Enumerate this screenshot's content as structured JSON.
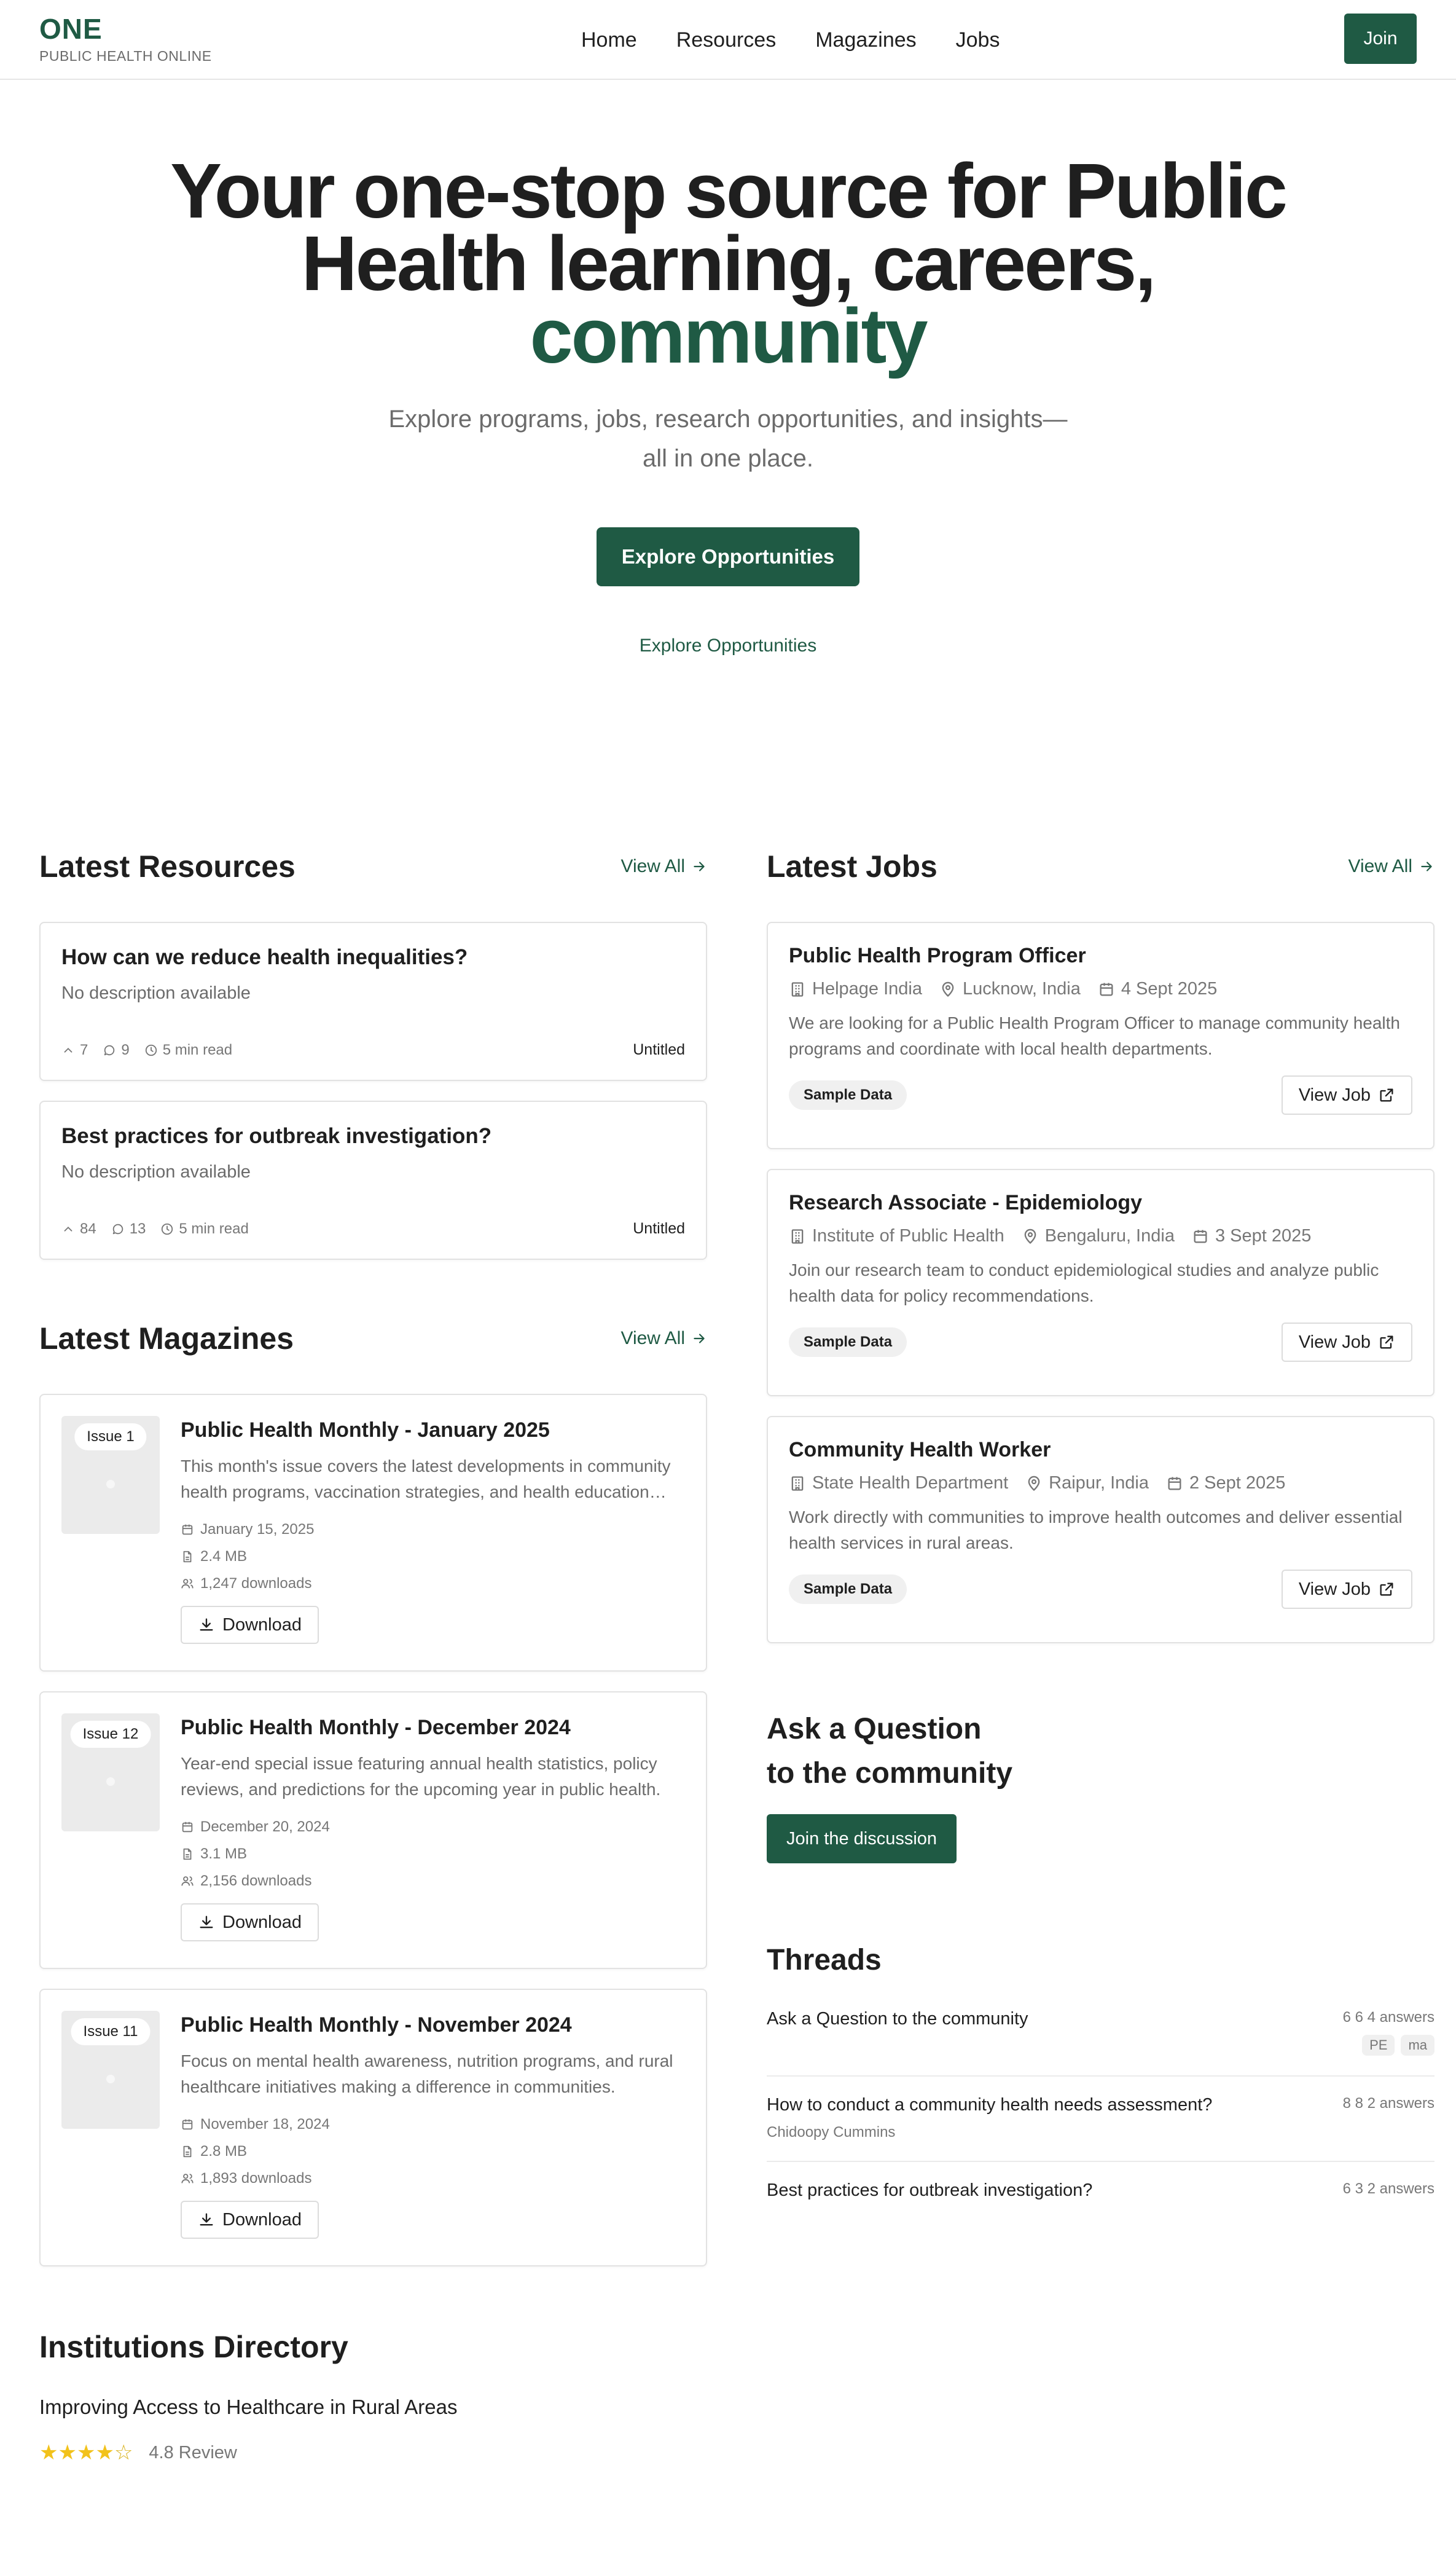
{
  "header": {
    "brand": "ONE",
    "tagline": "PUBLIC HEALTH ONLINE",
    "nav": [
      "Home",
      "Resources",
      "Magazines",
      "Jobs"
    ],
    "join_label": "Join"
  },
  "hero": {
    "title_line1": "Your one-stop source for Public",
    "title_line2": "Health learning, careers,",
    "title_accent": "community",
    "subtitle": "Explore programs, jobs, research opportunities, and insights—all in one place.",
    "cta_label": "Explore Opportunities",
    "link_label": "Explore Opportunities"
  },
  "resources": {
    "title": "Latest Resources",
    "view_all": "View All",
    "items": [
      {
        "title": "How can we reduce health inequalities?",
        "description": "No description available",
        "upvotes": "7",
        "comments": "9",
        "read_time": "5 min read",
        "category": "Untitled"
      },
      {
        "title": "Best practices for outbreak investigation?",
        "description": "No description available",
        "upvotes": "84",
        "comments": "13",
        "read_time": "5 min read",
        "category": "Untitled"
      }
    ]
  },
  "magazines": {
    "title": "Latest Magazines",
    "view_all": "View All",
    "download_label": "Download",
    "items": [
      {
        "issue": "Issue 1",
        "title": "Public Health Monthly - January 2025",
        "description": "This month's issue covers the latest developments in community health programs, vaccination strategies, and health education initiatives.",
        "date": "January 15, 2025",
        "size": "2.4 MB",
        "downloads": "1,247 downloads"
      },
      {
        "issue": "Issue 12",
        "title": "Public Health Monthly - December 2024",
        "description": "Year-end special issue featuring annual health statistics, policy reviews, and predictions for the upcoming year in public health.",
        "date": "December 20, 2024",
        "size": "3.1 MB",
        "downloads": "2,156 downloads"
      },
      {
        "issue": "Issue 11",
        "title": "Public Health Monthly - November 2024",
        "description": "Focus on mental health awareness, nutrition programs, and rural healthcare initiatives making a difference in communities.",
        "date": "November 18, 2024",
        "size": "2.8 MB",
        "downloads": "1,893 downloads"
      }
    ]
  },
  "jobs": {
    "title": "Latest Jobs",
    "view_all": "View All",
    "view_job_label": "View Job",
    "items": [
      {
        "title": "Public Health Program Officer",
        "org": "Helpage India",
        "location": "Lucknow, India",
        "date": "4 Sept 2025",
        "description": "We are looking for a Public Health Program Officer to manage community health programs and coordinate with local health departments.",
        "tag": "Sample Data"
      },
      {
        "title": "Research Associate - Epidemiology",
        "org": "Institute of Public Health",
        "location": "Bengaluru, India",
        "date": "3 Sept 2025",
        "description": "Join our research team to conduct epidemiological studies and analyze public health data for policy recommendations.",
        "tag": "Sample Data"
      },
      {
        "title": "Community Health Worker",
        "org": "State Health Department",
        "location": "Raipur, India",
        "date": "2 Sept 2025",
        "description": "Work directly with communities to improve health outcomes and deliver essential health services in rural areas.",
        "tag": "Sample Data"
      }
    ]
  },
  "ask": {
    "title_line1": "Ask a Question",
    "title_line2": "to the community",
    "button": "Join the discussion"
  },
  "threads": {
    "title": "Threads",
    "items": [
      {
        "title": "Ask a Question to the community",
        "author": "",
        "stats": "6 6 4 answers",
        "tags": [
          "PE",
          "ma"
        ]
      },
      {
        "title": "How to conduct a community health needs assessment?",
        "author": "Chidoopy Cummins",
        "stats": "8 8 2 answers",
        "tags": []
      },
      {
        "title": "Best practices for outbreak investigation?",
        "author": "",
        "stats": "6 3 2 answers",
        "tags": []
      }
    ]
  },
  "institutions": {
    "title": "Institutions Directory",
    "item_title": "Improving Access to Healthcare in Rural Areas",
    "rating": 4,
    "rating_max": 5,
    "rating_text": "4.8 Review"
  },
  "colors": {
    "accent": "#1f5a44",
    "star": "#f2c21b",
    "muted": "#6b6b6b"
  }
}
